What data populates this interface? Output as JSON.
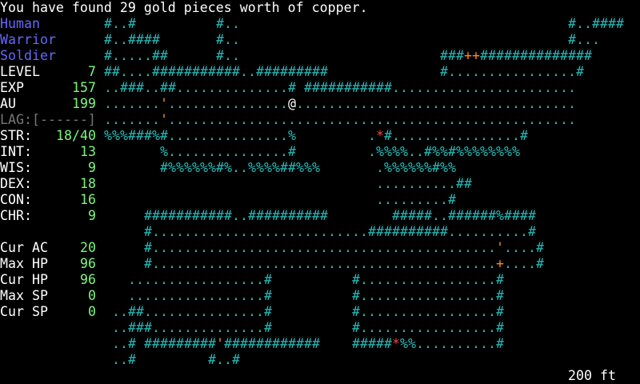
{
  "message": "You have found 29 gold pieces worth of copper.",
  "character": {
    "race": "Human",
    "class": "Warrior",
    "title": "Soldier"
  },
  "stats": [
    {
      "label": "LEVEL",
      "value": "7"
    },
    {
      "label": "EXP",
      "value": "157"
    },
    {
      "label": "AU",
      "value": "199"
    },
    {
      "label": "LAG:[------]",
      "value": ""
    },
    {
      "label": "STR:",
      "value": "18/40"
    },
    {
      "label": "INT:",
      "value": "13"
    },
    {
      "label": "WIS:",
      "value": "9"
    },
    {
      "label": "DEX:",
      "value": "18"
    },
    {
      "label": "CON:",
      "value": "16"
    },
    {
      "label": "CHR:",
      "value": "9"
    },
    {
      "label": "",
      "value": ""
    },
    {
      "label": "Cur AC",
      "value": "20"
    },
    {
      "label": "Max HP",
      "value": "96"
    },
    {
      "label": "Cur HP",
      "value": "96"
    },
    {
      "label": "Max SP",
      "value": "0"
    },
    {
      "label": "Cur SP",
      "value": "0"
    }
  ],
  "map_rows": [
    "#..#          #..                                         #..####",
    "#..####       #..                                         #...",
    "#.....##      #..                         ###++##############",
    "##....###########..#########              #................#",
    "..###..##..............# ###########.......................",
    ".......'...............@...................................",
    ".......'...................................................",
    "%%%###%#...............%         .*#................#",
    "       %...............#         .%%%%..#%%#%%%%%%%%",
    "       #%%%%%%#%..%%%%##%%%       .%%%%%%#%%",
    "                                  ..........##",
    "                                  .........#",
    "     ###########..##########        #####..######%####",
    "     #...........................##########..........#",
    "     #...........................................'....#",
    "     #...........................................+....#",
    "   .................#          #.................#",
    "   .................#          #.................#",
    " ..##...............#          #.................#",
    " ..###..............#          #.................#",
    " ..# #########'############    #####*%%..........#",
    " ..#         #..#"
  ],
  "depth": "200 ft",
  "colors": {
    "wall": "#2cb7b7",
    "stat_value": "#7cf77c",
    "char_info": "#6666ff",
    "lag": "#777777"
  }
}
